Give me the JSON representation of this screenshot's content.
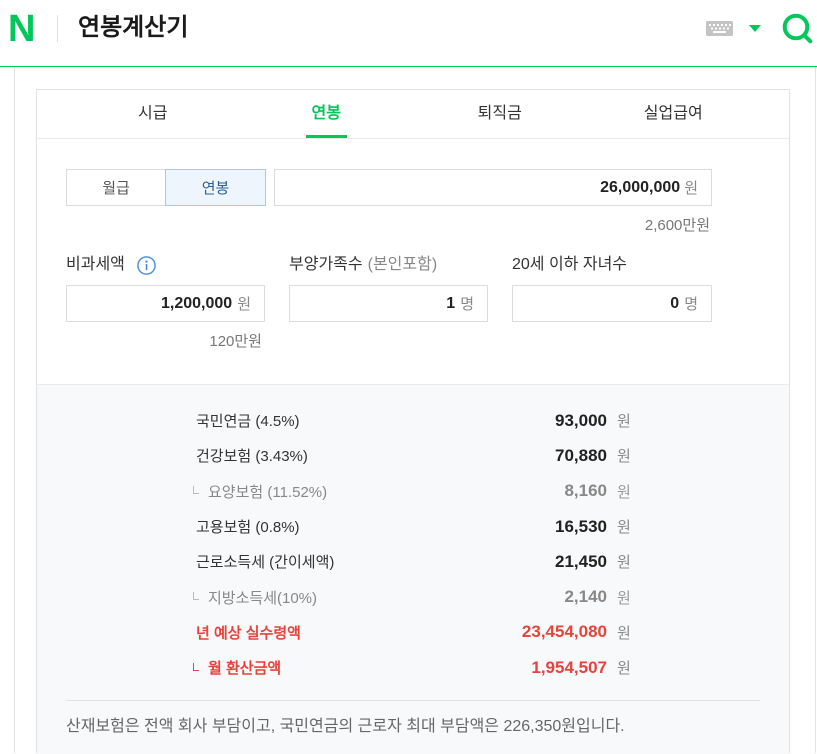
{
  "header": {
    "logo_text": "N",
    "title": "연봉계산기",
    "icons": {
      "keyboard": "keyboard-icon",
      "input_menu": "caret-down-icon",
      "search": "search-icon"
    }
  },
  "colors": {
    "brand_green": "#03c75a",
    "result_red": "#e9423a",
    "info_blue": "#4a8bdc",
    "selected_border": "#a7c9ee",
    "selected_bg": "#eef5fd"
  },
  "tabs": [
    {
      "label": "시급",
      "active": false
    },
    {
      "label": "연봉",
      "active": true
    },
    {
      "label": "퇴직금",
      "active": false
    },
    {
      "label": "실업급여",
      "active": false
    }
  ],
  "pay_type": {
    "options": [
      {
        "label": "월급",
        "selected": false
      },
      {
        "label": "연봉",
        "selected": true
      }
    ]
  },
  "salary": {
    "value": "26,000,000",
    "unit": "원",
    "hint": "2,600만원"
  },
  "non_taxable": {
    "label": "비과세액",
    "info_icon": "info-icon",
    "value": "1,200,000",
    "unit": "원",
    "hint": "120만원"
  },
  "dependents": {
    "label": "부양가족수",
    "note": "(본인포함)",
    "value": "1",
    "unit": "명"
  },
  "children": {
    "label": "20세 이하 자녀수",
    "value": "0",
    "unit": "명"
  },
  "results": [
    {
      "label": "국민연금 (4.5%)",
      "value": "93,000",
      "unit": "원"
    },
    {
      "label": "건강보험 (3.43%)",
      "value": "70,880",
      "unit": "원"
    },
    {
      "label": "요양보험 (11.52%)",
      "value": "8,160",
      "unit": "원"
    },
    {
      "label": "고용보험 (0.8%)",
      "value": "16,530",
      "unit": "원"
    },
    {
      "label": "근로소득세 (간이세액)",
      "value": "21,450",
      "unit": "원"
    },
    {
      "label": "지방소득세(10%)",
      "value": "2,140",
      "unit": "원"
    },
    {
      "label": "년 예상 실수령액",
      "value": "23,454,080",
      "unit": "원"
    },
    {
      "label": "월 환산금액",
      "value": "1,954,507",
      "unit": "원"
    }
  ],
  "footer_note": "산재보험은 전액 회사 부담이고, 국민연금의 근로자 최대 부담액은 226,350원입니다."
}
